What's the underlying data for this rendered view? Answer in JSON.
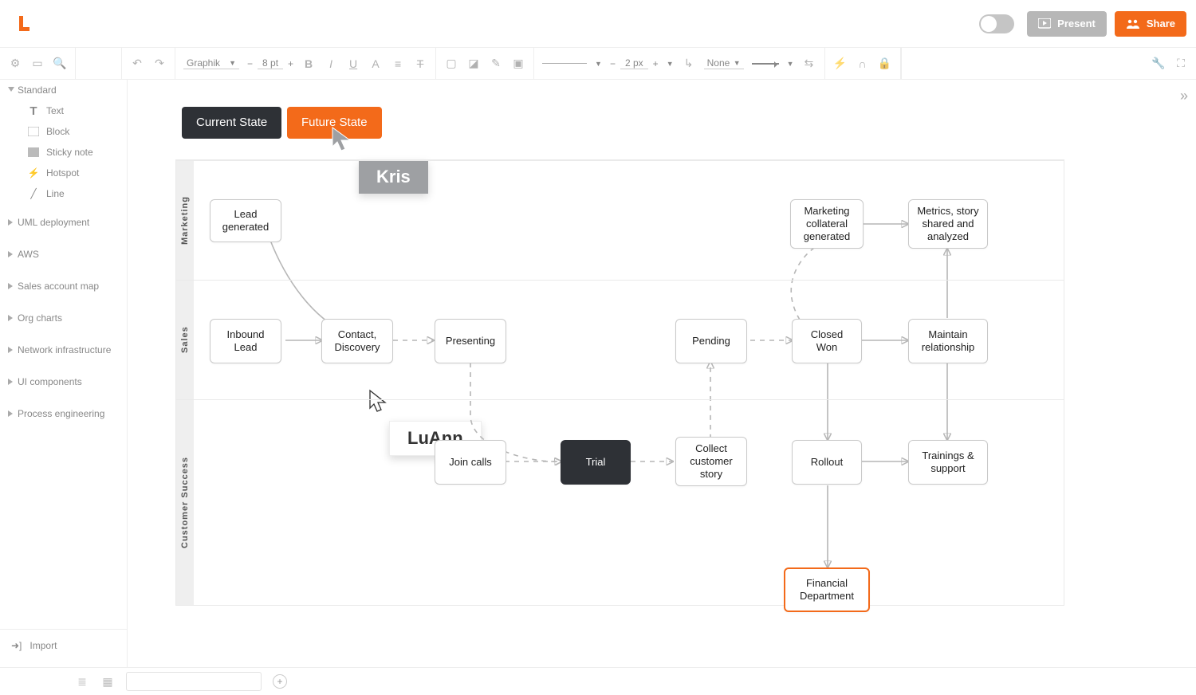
{
  "colors": {
    "accent": "#f36a1a",
    "dark": "#2e3136",
    "muted": "#b7b7b7"
  },
  "header": {
    "present_label": "Present",
    "share_label": "Share"
  },
  "toolbar": {
    "font_family": "Graphik",
    "font_size": "8 pt",
    "stroke_width": "2 px",
    "line_end": "None"
  },
  "sidebar": {
    "open_section": "Standard",
    "shapes": [
      {
        "id": "text",
        "label": "Text"
      },
      {
        "id": "block",
        "label": "Block"
      },
      {
        "id": "sticky",
        "label": "Sticky note"
      },
      {
        "id": "hotspot",
        "label": "Hotspot"
      },
      {
        "id": "line",
        "label": "Line"
      }
    ],
    "collapsed_sections": [
      "UML deployment",
      "AWS",
      "Sales account map",
      "Org charts",
      "Network infrastructure",
      "UI components",
      "Process engineering"
    ],
    "import_label": "Import"
  },
  "canvas": {
    "tabs": {
      "current": "Current State",
      "future": "Future State"
    },
    "cursors": {
      "kris": "Kris",
      "luann": "LuAnn"
    },
    "lanes": {
      "marketing": "Marketing",
      "sales": "Sales",
      "customer_success": "Customer Success"
    },
    "nodes": {
      "lead_generated": "Lead generated",
      "marketing_collateral": "Marketing collateral generated",
      "metrics": "Metrics, story shared and analyzed",
      "inbound_lead": "Inbound Lead",
      "contact_discovery": "Contact, Discovery",
      "presenting": "Presenting",
      "pending": "Pending",
      "closed_won": "Closed Won",
      "maintain_relationship": "Maintain relationship",
      "join_calls": "Join calls",
      "trial": "Trial",
      "collect_story": "Collect customer story",
      "rollout": "Rollout",
      "trainings_support": "Trainings & support",
      "financial_dept": "Financial Department"
    }
  }
}
